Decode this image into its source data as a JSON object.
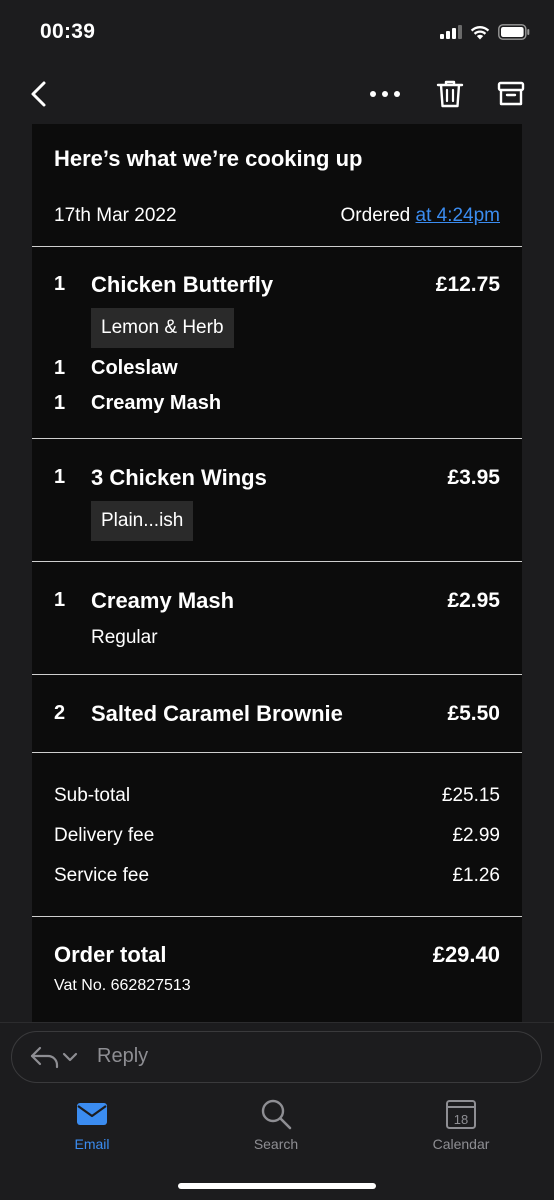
{
  "status_bar": {
    "time": "00:39"
  },
  "email": {
    "heading": "Here’s what we’re cooking up",
    "date": "17th Mar 2022",
    "ordered_label": "Ordered",
    "ordered_time_link": "at 4:24pm"
  },
  "items": [
    {
      "qty": "1",
      "name": "Chicken Butterfly",
      "price": "£12.75",
      "tag": "Lemon & Herb",
      "sides": [
        {
          "qty": "1",
          "name": "Coleslaw"
        },
        {
          "qty": "1",
          "name": "Creamy Mash"
        }
      ]
    },
    {
      "qty": "1",
      "name": "3 Chicken Wings",
      "price": "£3.95",
      "tag": "Plain...ish"
    },
    {
      "qty": "1",
      "name": "Creamy Mash",
      "price": "£2.95",
      "variant": "Regular"
    },
    {
      "qty": "2",
      "name": "Salted Caramel Brownie",
      "price": "£5.50"
    }
  ],
  "summary": {
    "subtotal_label": "Sub-total",
    "subtotal_value": "£25.15",
    "delivery_label": "Delivery fee",
    "delivery_value": "£2.99",
    "service_label": "Service fee",
    "service_value": "£1.26"
  },
  "total": {
    "label": "Order total",
    "value": "£29.40",
    "vat": "Vat No. 662827513"
  },
  "reply": {
    "placeholder": "Reply"
  },
  "tabs": [
    {
      "label": "Email",
      "icon": "envelope-icon",
      "active": true
    },
    {
      "label": "Search",
      "icon": "search-icon"
    },
    {
      "label": "Calendar",
      "icon": "calendar-icon",
      "day": "18"
    }
  ],
  "colors": {
    "accent": "#3b8cf0",
    "background": "#1c1c1e",
    "card": "#0c0c0c",
    "tag": "#2a2a2a"
  }
}
